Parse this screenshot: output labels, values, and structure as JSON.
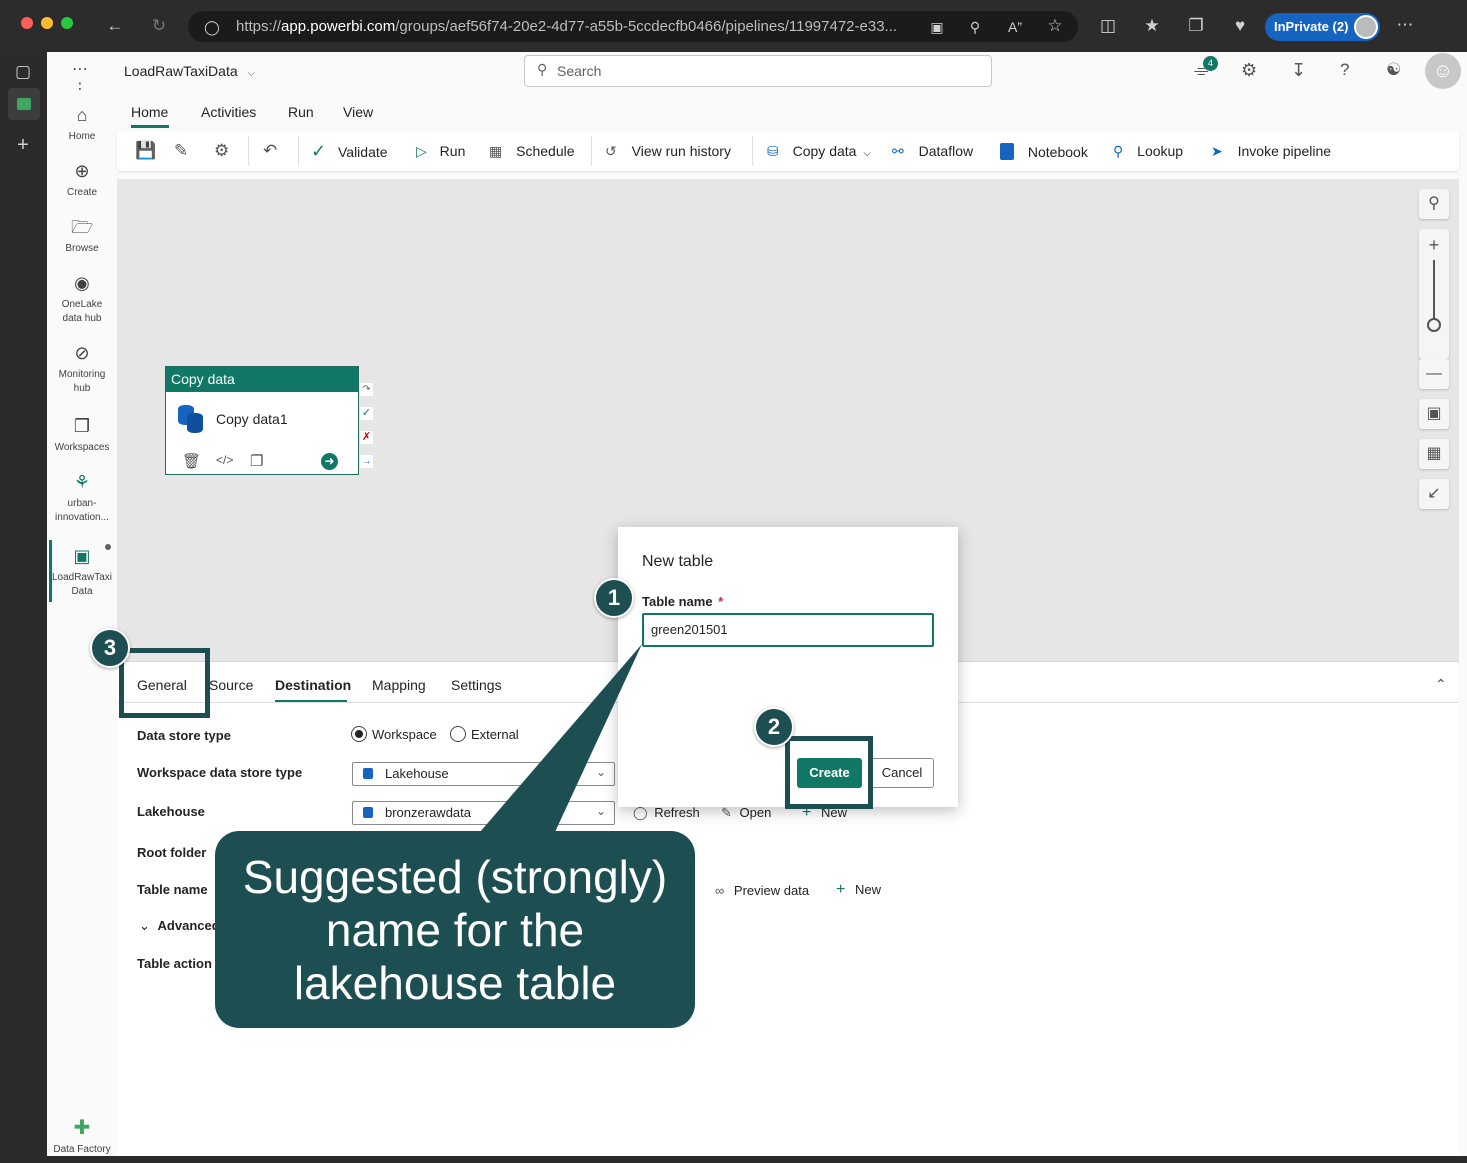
{
  "browser": {
    "url_prefix": "https://",
    "url_host": "app.powerbi.com",
    "url_path": "/groups/aef56f74-20e2-4d77-a55b-5ccdecfb0466/pipelines/11997472-e33...",
    "inprivate_label": "InPrivate (2)"
  },
  "app": {
    "pipeline_name": "LoadRawTaxiData",
    "search_placeholder": "Search",
    "notification_count": "4"
  },
  "left_nav": [
    {
      "label": "Home"
    },
    {
      "label": "Create"
    },
    {
      "label": "Browse"
    },
    {
      "label": "OneLake data hub"
    },
    {
      "label": "Monitoring hub"
    },
    {
      "label": "Workspaces"
    },
    {
      "label": "urban-innovation..."
    },
    {
      "label": "LoadRawTaxiData"
    },
    {
      "label": "Data Factory"
    }
  ],
  "ribbon": {
    "tabs": [
      "Home",
      "Activities",
      "Run",
      "View"
    ],
    "active_tab": "Home",
    "validate": "Validate",
    "run": "Run",
    "schedule": "Schedule",
    "view_run_history": "View run history",
    "copy_data": "Copy data",
    "dataflow": "Dataflow",
    "notebook": "Notebook",
    "lookup": "Lookup",
    "invoke_pipeline": "Invoke pipeline"
  },
  "activity": {
    "header": "Copy data",
    "name": "Copy data1"
  },
  "panel": {
    "tabs": [
      "General",
      "Source",
      "Destination",
      "Mapping",
      "Settings"
    ],
    "active_tab": "Destination",
    "data_store_type_label": "Data store type",
    "workspace_option": "Workspace",
    "external_option": "External",
    "workspace_store_label": "Workspace data store type",
    "workspace_store_value": "Lakehouse",
    "lakehouse_label": "Lakehouse",
    "lakehouse_value": "bronzerawdata",
    "refresh": "Refresh",
    "open": "Open",
    "new": "New",
    "root_folder_label": "Root folder",
    "table_name_label": "Table name",
    "preview_data": "Preview data",
    "advanced_label": "Advanced",
    "table_action_label": "Table action"
  },
  "dialog": {
    "title": "New table",
    "field_label": "Table name",
    "required_mark": "*",
    "field_value": "green201501",
    "create": "Create",
    "cancel": "Cancel"
  },
  "annotations": {
    "badge1": "1",
    "badge2": "2",
    "badge3": "3",
    "callout_text": "Suggested (strongly) name for the lakehouse table"
  },
  "colors": {
    "accent": "#117865",
    "annotation": "#1d4f52",
    "inprivate": "#1565c0"
  }
}
